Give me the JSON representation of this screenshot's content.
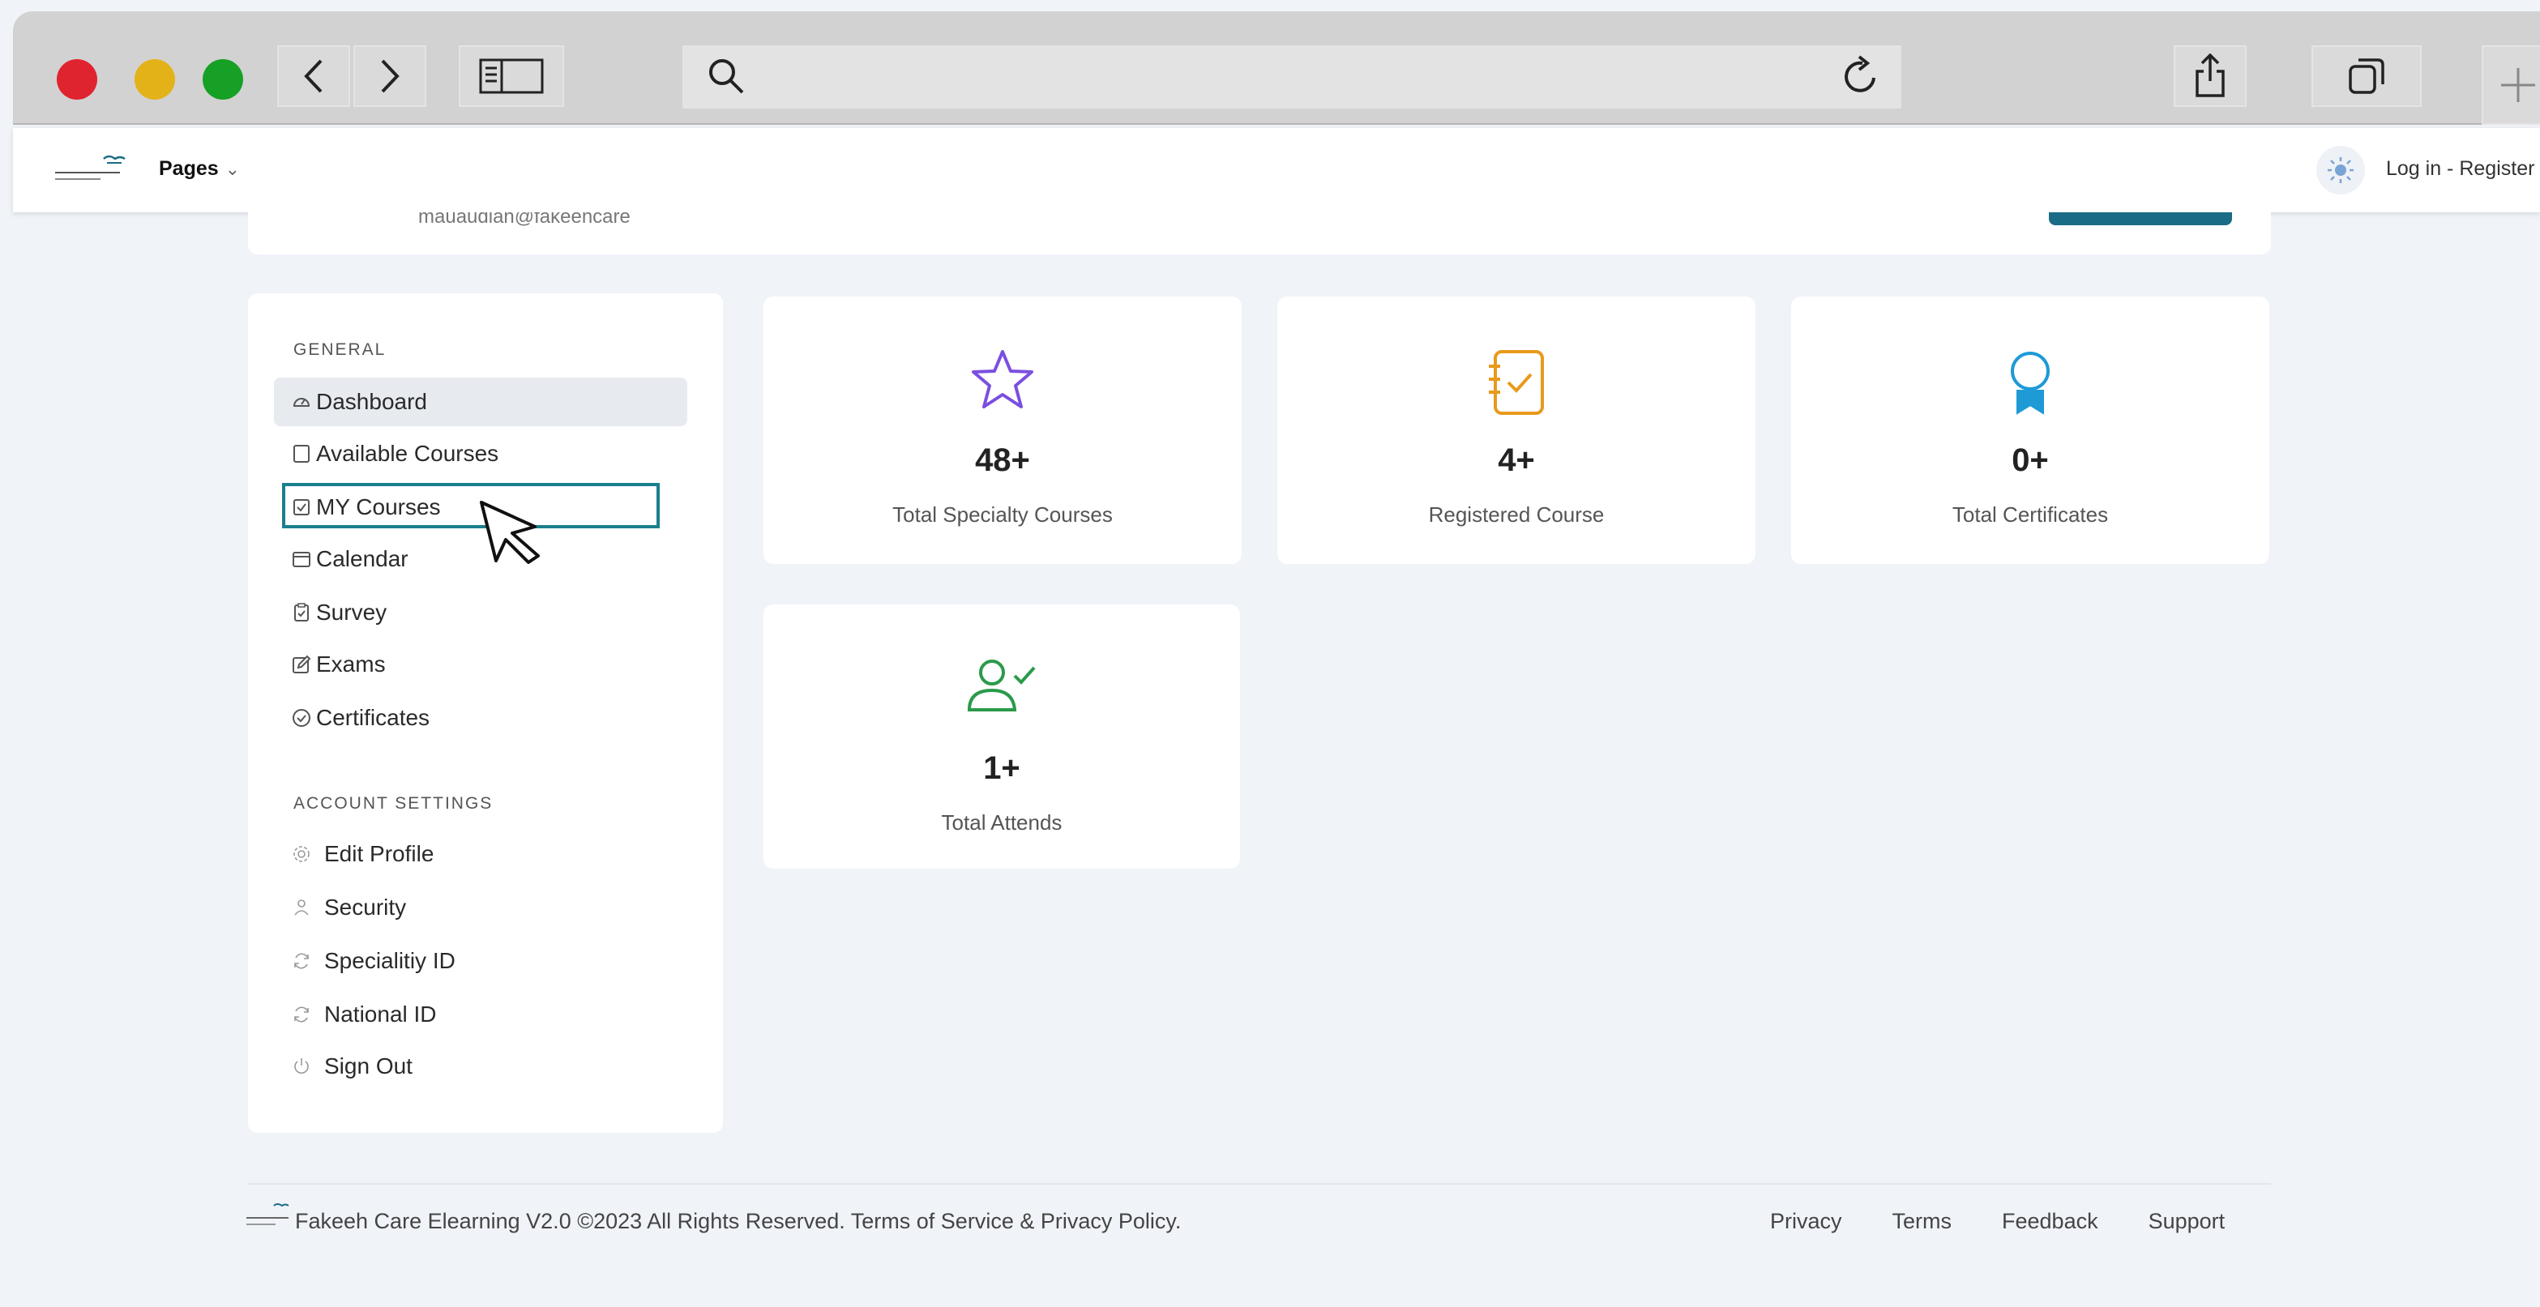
{
  "browser": {
    "icons": {
      "back": "chevron-left-icon",
      "forward": "chevron-right-icon",
      "sidebar": "sidebar-toggle-icon",
      "search": "search-icon",
      "reload": "reload-icon",
      "share": "share-icon",
      "tabs": "tabs-icon",
      "new_tab": "plus-icon"
    }
  },
  "header": {
    "pages_label": "Pages",
    "pages_chevron": "⌄",
    "login_label": "Log in - Register"
  },
  "profile": {
    "email": "mauaudlan@fakeehcare"
  },
  "sidebar": {
    "general_title": "GENERAL",
    "general_items": [
      {
        "label": "Dashboard",
        "icon": "gauge-icon"
      },
      {
        "label": "Available Courses",
        "icon": "square-icon"
      },
      {
        "label": "MY Courses",
        "icon": "checkbox-icon"
      },
      {
        "label": "Calendar",
        "icon": "calendar-icon"
      },
      {
        "label": "Survey",
        "icon": "clipboard-icon"
      },
      {
        "label": "Exams",
        "icon": "edit-icon"
      },
      {
        "label": "Certificates",
        "icon": "check-circle-icon"
      }
    ],
    "account_title": "ACCOUNT SETTINGS",
    "account_items": [
      {
        "label": "Edit Profile",
        "icon": "gear-icon"
      },
      {
        "label": "Security",
        "icon": "user-icon"
      },
      {
        "label": "Specialitiy ID",
        "icon": "refresh-icon"
      },
      {
        "label": "National ID",
        "icon": "refresh-icon"
      },
      {
        "label": "Sign Out",
        "icon": "power-icon"
      }
    ]
  },
  "stats": [
    {
      "value": "48+",
      "label": "Total Specialty Courses",
      "icon": "star-icon",
      "color": "#7b4fe0"
    },
    {
      "value": "4+",
      "label": "Registered Course",
      "icon": "notebook-icon",
      "color": "#e79a1c"
    },
    {
      "value": "0+",
      "label": "Total Certificates",
      "icon": "award-icon",
      "color": "#1e9ad6"
    },
    {
      "value": "1+",
      "label": "Total Attends",
      "icon": "user-check-icon",
      "color": "#2a9a4a"
    }
  ],
  "footer": {
    "copyright": "Fakeeh Care Elearning V2.0 ©2023 All Rights Reserved. Terms of Service & Privacy Policy.",
    "links": [
      "Privacy",
      "Terms",
      "Feedback",
      "Support"
    ]
  },
  "colors": {
    "accent": "#1a7f8e",
    "page_bg": "#f0f3f8"
  }
}
